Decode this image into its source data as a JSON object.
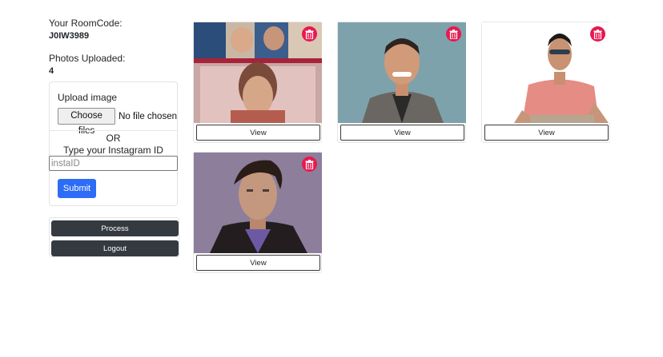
{
  "room": {
    "code_label": "Your RoomCode:",
    "code": "J0IW3989",
    "photos_label": "Photos Uploaded:",
    "photos_count": "4"
  },
  "upload": {
    "label": "Upload image",
    "choose_button": "Choose files",
    "file_status": "No file chosen",
    "or_text": "OR",
    "instagram_label": "Type your Instagram ID",
    "instagram_placeholder": "instaID",
    "instagram_value": "",
    "submit_label": "Submit"
  },
  "actions": {
    "process_label": "Process",
    "logout_label": "Logout"
  },
  "photos": [
    {
      "view_label": "View",
      "icon": "trash-icon"
    },
    {
      "view_label": "View",
      "icon": "trash-icon"
    },
    {
      "view_label": "View",
      "icon": "trash-icon"
    },
    {
      "view_label": "View",
      "icon": "trash-icon"
    }
  ],
  "colors": {
    "primary": "#2d6cf6",
    "dark": "#343a40",
    "delete": "#e8194f"
  }
}
